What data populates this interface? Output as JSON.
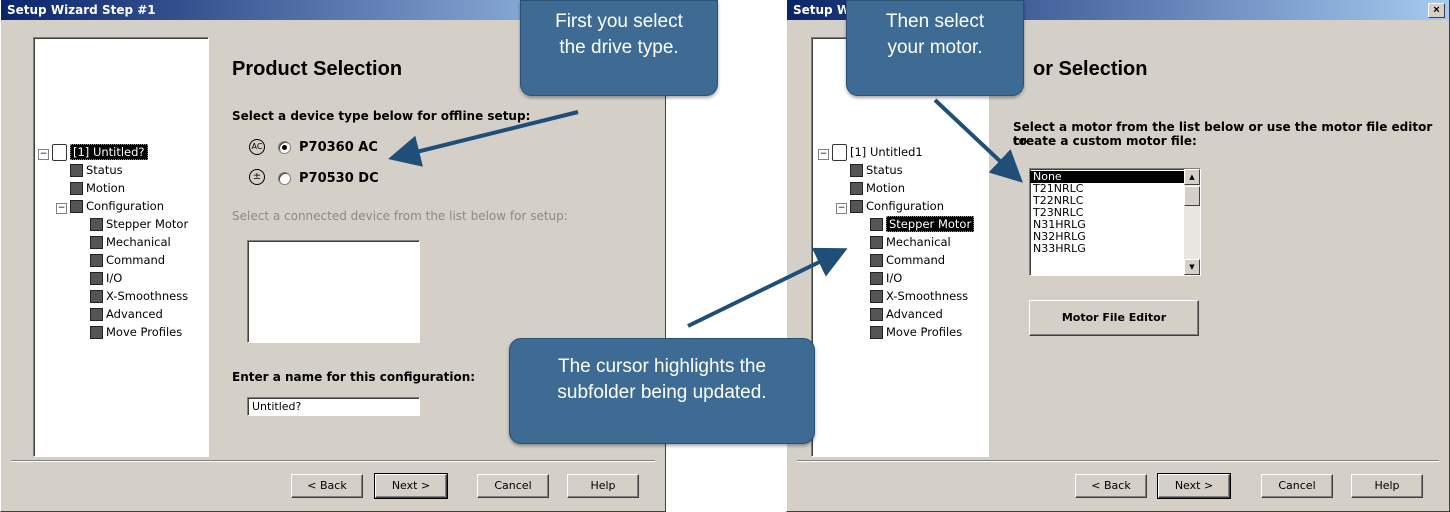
{
  "colors": {
    "callout": "#3d6b93",
    "arrow": "#1f4e79",
    "titlebar": "#0a246a",
    "dialog": "#d4d0c8"
  },
  "left_window": {
    "title": "Setup Wizard Step #1",
    "heading": "Product Selection",
    "device_type_label": "Select a device type below for offline setup:",
    "options": [
      {
        "symbol": "AC",
        "label": "P70360 AC",
        "selected": true
      },
      {
        "symbol": "±",
        "label": "P70530 DC",
        "selected": false
      }
    ],
    "connected_label": "Select a connected device from the list below for setup:",
    "name_label": "Enter a name for this configuration:",
    "name_value": "Untitled?",
    "tree": {
      "root": "[1] Untitled?",
      "items": [
        "Status",
        "Motion",
        "Configuration",
        "Stepper Motor",
        "Mechanical",
        "Command",
        "I/O",
        "X-Smoothness",
        "Advanced",
        "Move Profiles"
      ]
    },
    "buttons": {
      "back": "< Back",
      "next": "Next >",
      "cancel": "Cancel",
      "help": "Help"
    }
  },
  "right_window": {
    "title": "Setup Wi",
    "close": "×",
    "heading": "or Selection",
    "motor_label_line1": "Select a motor from the list below or use the motor file editor to",
    "motor_label_line2": "create a custom motor file:",
    "motors": [
      "None",
      "T21NRLC",
      "T22NRLC",
      "T23NRLC",
      "N31HRLG",
      "N32HRLG",
      "N33HRLG"
    ],
    "selected_motor": "None",
    "editor_button": "Motor File Editor",
    "tree": {
      "root": "[1] Untitled1",
      "items": [
        "Status",
        "Motion",
        "Configuration",
        "Stepper Motor",
        "Mechanical",
        "Command",
        "I/O",
        "X-Smoothness",
        "Advanced",
        "Move Profiles"
      ]
    },
    "buttons": {
      "back": "< Back",
      "next": "Next >",
      "cancel": "Cancel",
      "help": "Help"
    }
  },
  "callouts": {
    "first_line1": "First you select",
    "first_line2": "the drive type.",
    "then_line1": "Then select",
    "then_line2": "your motor.",
    "cursor_line1": "The cursor highlights the",
    "cursor_line2": "subfolder being updated."
  }
}
